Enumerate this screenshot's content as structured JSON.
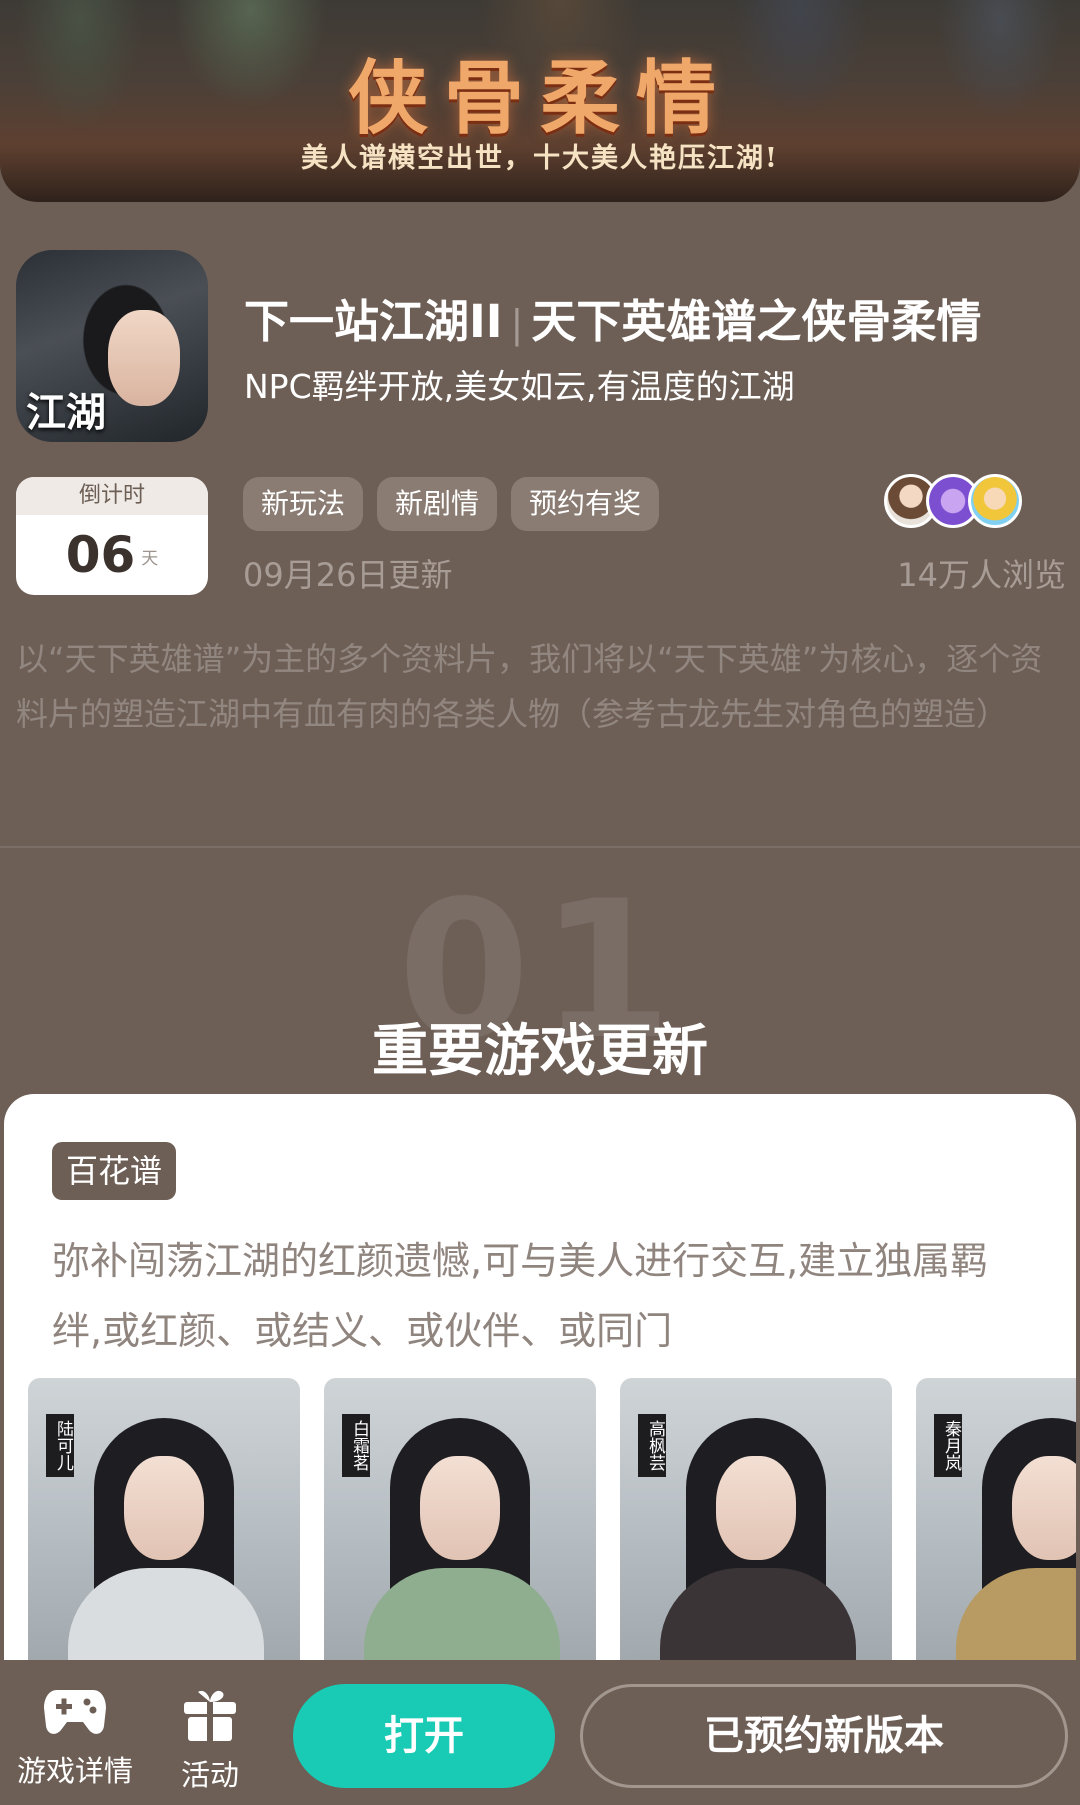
{
  "banner": {
    "title": "侠骨柔情",
    "subtitle": "美人谱横空出世，十大美人艳压江湖!"
  },
  "game": {
    "icon_text": "江湖",
    "title_part1": "下一站江湖II",
    "title_separator": "|",
    "title_part2": "天下英雄谱之侠骨柔情",
    "subtitle": "NPC羁绊开放,美女如云,有温度的江湖"
  },
  "countdown": {
    "label": "倒计时",
    "value": "06",
    "unit": "天"
  },
  "tags": [
    "新玩法",
    "新剧情",
    "预约有奖"
  ],
  "update_date": "09月26日更新",
  "views": "14万人浏览",
  "description": "以“天下英雄谱”为主的多个资料片，我们将以“天下英雄”为核心，逐个资料片的塑造江湖中有血有肉的各类人物（参考古龙先生对角色的塑造）",
  "section": {
    "number": "01",
    "title": "重要游戏更新"
  },
  "card": {
    "tag": "百花谱",
    "description": "弥补闯荡江湖的红颜遗憾,可与美人进行交互,建立独属羁绊,或红颜、或结义、或伙伴、或同门",
    "portraits": [
      {
        "name": "陆可儿",
        "color": "#d9dde0"
      },
      {
        "name": "白霜茗",
        "color": "#8fae8f"
      },
      {
        "name": "高枫芸",
        "color": "#3a3436"
      },
      {
        "name": "秦月岚",
        "color": "#b89a63"
      }
    ]
  },
  "bottom_bar": {
    "details_label": "游戏详情",
    "activity_label": "活动",
    "open_label": "打开",
    "reserved_label": "已预约新版本"
  },
  "colors": {
    "background": "#6d5f56",
    "accent": "#19cbb4",
    "tag": "#8a7c73"
  }
}
